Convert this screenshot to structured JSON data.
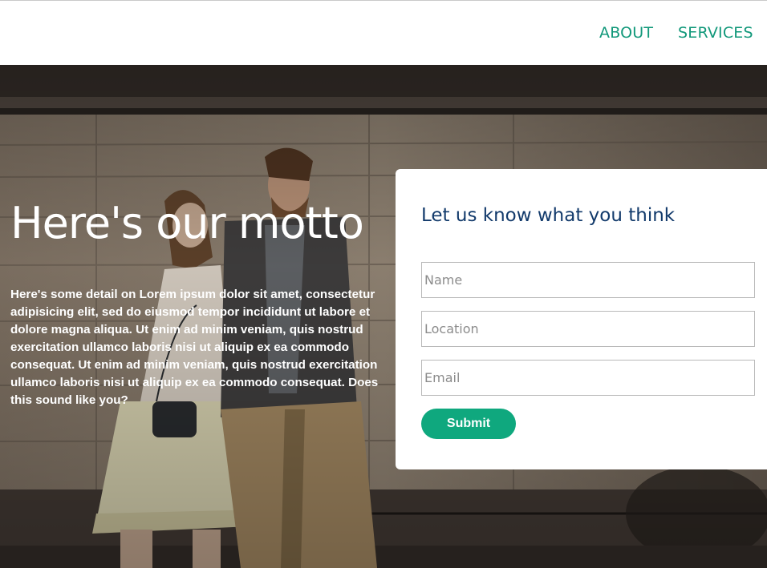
{
  "nav": {
    "about": "ABOUT",
    "services": "SERVICES"
  },
  "hero": {
    "title": "Here's our motto",
    "detail": "Here's some detail on Lorem ipsum dolor sit amet, consectetur adipisicing elit, sed do eiusmod tempor incididunt ut labore et dolore magna aliqua. Ut enim ad minim veniam, quis nostrud exercitation ullamco laboris nisi ut aliquip ex ea commodo consequat. Ut enim ad minim veniam, quis nostrud exercitation ullamco laboris nisi ut aliquip ex ea commodo consequat. Does this sound like you?"
  },
  "form": {
    "title": "Let us know what you think",
    "name_placeholder": "Name",
    "location_placeholder": "Location",
    "email_placeholder": "Email",
    "submit_label": "Submit"
  },
  "colors": {
    "accent": "#0fa87e",
    "nav_link": "#11987a",
    "form_title": "#123a6b"
  }
}
